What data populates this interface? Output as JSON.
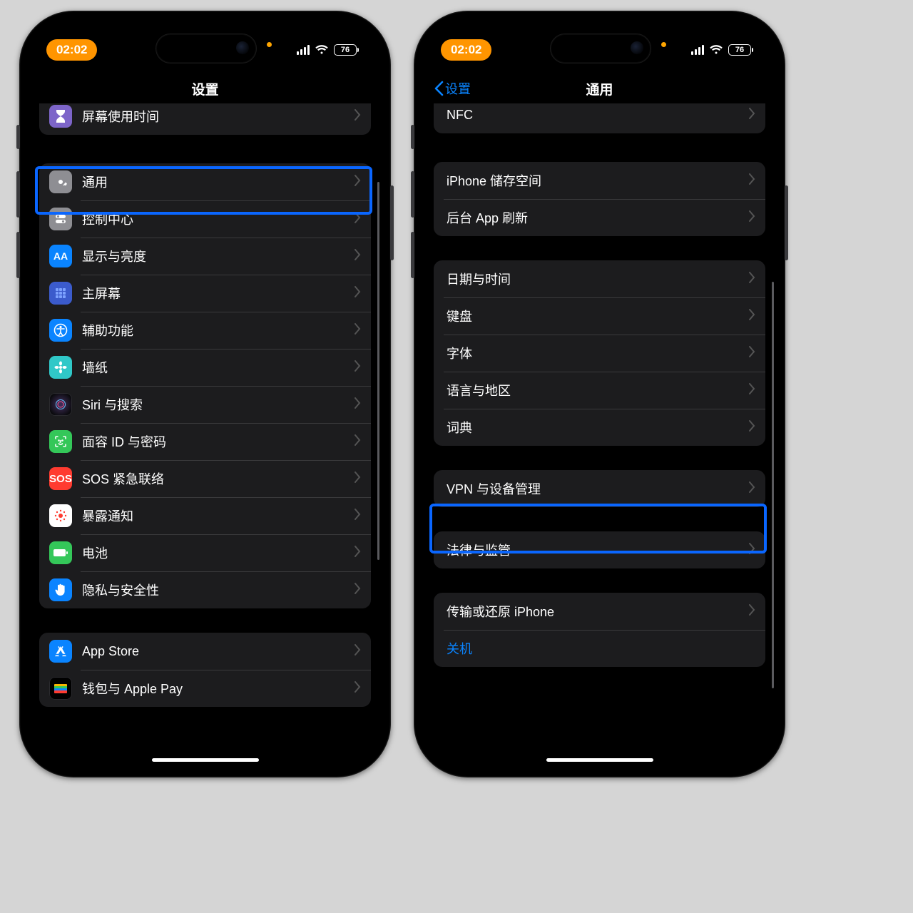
{
  "status": {
    "time": "02:02",
    "battery": "76"
  },
  "left": {
    "title": "设置",
    "group_top_partial": {
      "label": "屏幕使用时间"
    },
    "group2": [
      {
        "key": "general",
        "label": "通用",
        "highlighted": true
      },
      {
        "key": "control",
        "label": "控制中心"
      },
      {
        "key": "display",
        "label": "显示与亮度"
      },
      {
        "key": "home",
        "label": "主屏幕"
      },
      {
        "key": "access",
        "label": "辅助功能"
      },
      {
        "key": "wall",
        "label": "墙纸"
      },
      {
        "key": "siri",
        "label": "Siri 与搜索"
      },
      {
        "key": "faceid",
        "label": "面容 ID 与密码"
      },
      {
        "key": "sos",
        "label": "SOS 紧急联络"
      },
      {
        "key": "expose",
        "label": "暴露通知"
      },
      {
        "key": "battery",
        "label": "电池"
      },
      {
        "key": "privacy",
        "label": "隐私与安全性"
      }
    ],
    "group3": [
      {
        "key": "appstore",
        "label": "App Store"
      },
      {
        "key": "wallet",
        "label": "钱包与 Apple Pay"
      }
    ]
  },
  "right": {
    "back": "设置",
    "title": "通用",
    "g1": [
      {
        "label": "NFC"
      }
    ],
    "g2": [
      {
        "label": "iPhone 储存空间"
      },
      {
        "label": "后台 App 刷新"
      }
    ],
    "g3": [
      {
        "label": "日期与时间"
      },
      {
        "label": "键盘"
      },
      {
        "label": "字体"
      },
      {
        "label": "语言与地区"
      },
      {
        "label": "词典"
      }
    ],
    "g4": [
      {
        "label": "VPN 与设备管理",
        "highlighted": true
      }
    ],
    "g5": [
      {
        "label": "法律与监管"
      }
    ],
    "g6": [
      {
        "label": "传输或还原 iPhone"
      },
      {
        "label": "关机",
        "blue": true,
        "no_chevron": true
      }
    ]
  }
}
